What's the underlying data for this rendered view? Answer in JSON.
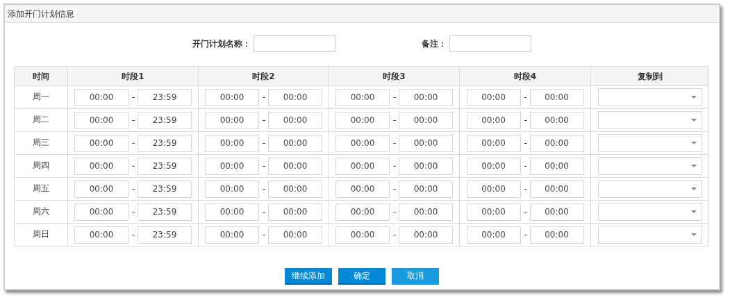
{
  "dialog": {
    "title": "添加开门计划信息"
  },
  "form": {
    "fields": [
      {
        "label": "开门计划名称："
      },
      {
        "label": "备注："
      }
    ]
  },
  "table": {
    "columns": [
      "时间",
      "时段1",
      "时段2",
      "时段3",
      "时段4",
      "复制到"
    ],
    "rows": [
      {
        "day": "周一",
        "periods": [
          {
            "start": "00:00",
            "sep": "-",
            "end": "23:59"
          },
          {
            "start": "00:00",
            "sep": "-",
            "end": "00:00"
          },
          {
            "start": "00:00",
            "sep": "-",
            "end": "00:00"
          },
          {
            "start": "00:00",
            "sep": "-",
            "end": "00:00"
          }
        ]
      },
      {
        "day": "周二",
        "periods": [
          {
            "start": "00:00",
            "sep": "-",
            "end": "23:59"
          },
          {
            "start": "00:00",
            "sep": "-",
            "end": "00:00"
          },
          {
            "start": "00:00",
            "sep": "-",
            "end": "00:00"
          },
          {
            "start": "00:00",
            "sep": "-",
            "end": "00:00"
          }
        ]
      },
      {
        "day": "周三",
        "periods": [
          {
            "start": "00:00",
            "sep": "-",
            "end": "23:59"
          },
          {
            "start": "00:00",
            "sep": "-",
            "end": "00:00"
          },
          {
            "start": "00:00",
            "sep": "-",
            "end": "00:00"
          },
          {
            "start": "00:00",
            "sep": "-",
            "end": "00:00"
          }
        ]
      },
      {
        "day": "周四",
        "periods": [
          {
            "start": "00:00",
            "sep": "-",
            "end": "23:59"
          },
          {
            "start": "00:00",
            "sep": "-",
            "end": "00:00"
          },
          {
            "start": "00:00",
            "sep": "-",
            "end": "00:00"
          },
          {
            "start": "00:00",
            "sep": "-",
            "end": "00:00"
          }
        ]
      },
      {
        "day": "周五",
        "periods": [
          {
            "start": "00:00",
            "sep": "-",
            "end": "23:59"
          },
          {
            "start": "00:00",
            "sep": "-",
            "end": "00:00"
          },
          {
            "start": "00:00",
            "sep": "-",
            "end": "00:00"
          },
          {
            "start": "00:00",
            "sep": "-",
            "end": "00:00"
          }
        ]
      },
      {
        "day": "周六",
        "periods": [
          {
            "start": "00:00",
            "sep": "-",
            "end": "23:59"
          },
          {
            "start": "00:00",
            "sep": "-",
            "end": "00:00"
          },
          {
            "start": "00:00",
            "sep": "-",
            "end": "00:00"
          },
          {
            "start": "00:00",
            "sep": "-",
            "end": "00:00"
          }
        ]
      },
      {
        "day": "周日",
        "periods": [
          {
            "start": "00:00",
            "sep": "-",
            "end": "23:59"
          },
          {
            "start": "00:00",
            "sep": "-",
            "end": "00:00"
          },
          {
            "start": "00:00",
            "sep": "-",
            "end": "00:00"
          },
          {
            "start": "00:00",
            "sep": "-",
            "end": "00:00"
          }
        ]
      }
    ]
  },
  "buttons": [
    {
      "label": "继续添加",
      "kind": "primary"
    },
    {
      "label": "确定",
      "kind": "primary"
    },
    {
      "label": "取消",
      "kind": "secondary"
    }
  ]
}
